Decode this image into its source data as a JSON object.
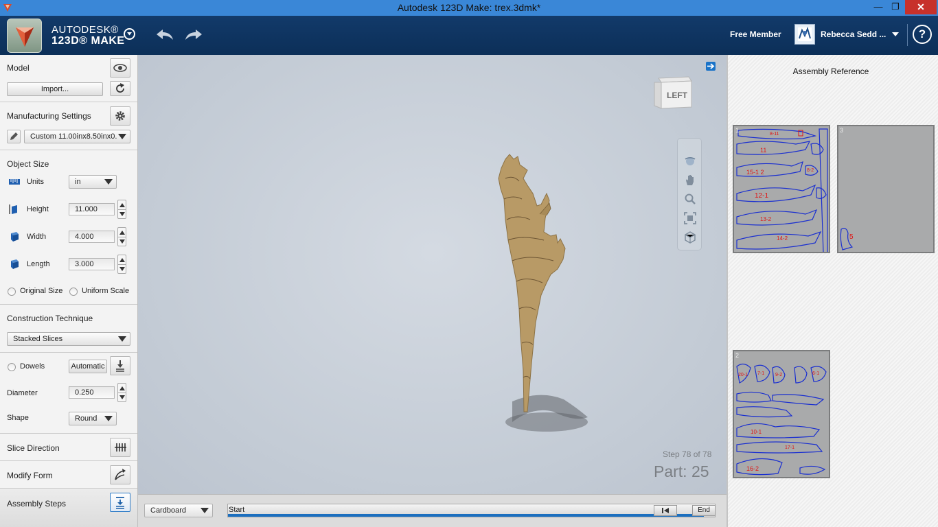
{
  "window": {
    "title": "Autodesk 123D Make: trex.3dmk*",
    "minimize": "—",
    "restore": "❐",
    "close": "✕"
  },
  "header": {
    "brand_line1": "AUTODESK®",
    "brand_line2": "123D® MAKE",
    "membership": "Free Member",
    "user_name": "Rebecca Sedd ...",
    "help": "?"
  },
  "left_panel": {
    "model": {
      "title": "Model",
      "import_label": "Import..."
    },
    "manufacturing": {
      "title": "Manufacturing Settings",
      "preset": "Custom 11.00inx8.50inx0."
    },
    "object_size": {
      "title": "Object Size",
      "units_label": "Units",
      "units_value": "in",
      "height_label": "Height",
      "height_value": "11.000",
      "width_label": "Width",
      "width_value": "4.000",
      "length_label": "Length",
      "length_value": "3.000",
      "original_size": "Original Size",
      "uniform_scale": "Uniform Scale"
    },
    "construction": {
      "title": "Construction Technique",
      "technique": "Stacked Slices"
    },
    "dowels": {
      "label": "Dowels",
      "mode": "Automatic",
      "diameter_label": "Diameter",
      "diameter_value": "0.250",
      "shape_label": "Shape",
      "shape_value": "Round"
    },
    "slice_direction": "Slice Direction",
    "modify_form": "Modify Form",
    "assembly_steps": "Assembly Steps"
  },
  "viewport": {
    "viewcube_label": "LEFT",
    "step_text": "Step 78 of 78",
    "part_text": "Part: 25"
  },
  "bottom_bar": {
    "material": "Cardboard",
    "timeline_start": "Start",
    "timeline_end": "End",
    "progress": 0.98
  },
  "right_panel": {
    "title": "Assembly Reference",
    "sheets": [
      {
        "number": "1",
        "labels": [
          "8-11",
          "11",
          "15-1 2",
          "12-1",
          "13-2",
          "14-2",
          "8-2"
        ]
      },
      {
        "number": "3",
        "labels": [
          "5"
        ]
      },
      {
        "number": "2",
        "labels": [
          "20-1",
          "7-1",
          "9-2",
          "10-1",
          "17-1",
          "16-2",
          "6-1"
        ]
      }
    ]
  },
  "colors": {
    "title_bar": "#3a87d7",
    "header": "#0f3460",
    "accent": "#1c6fbf",
    "cut_line": "#1a2fd0",
    "part_label": "#e01515",
    "model": "#b89a66"
  }
}
